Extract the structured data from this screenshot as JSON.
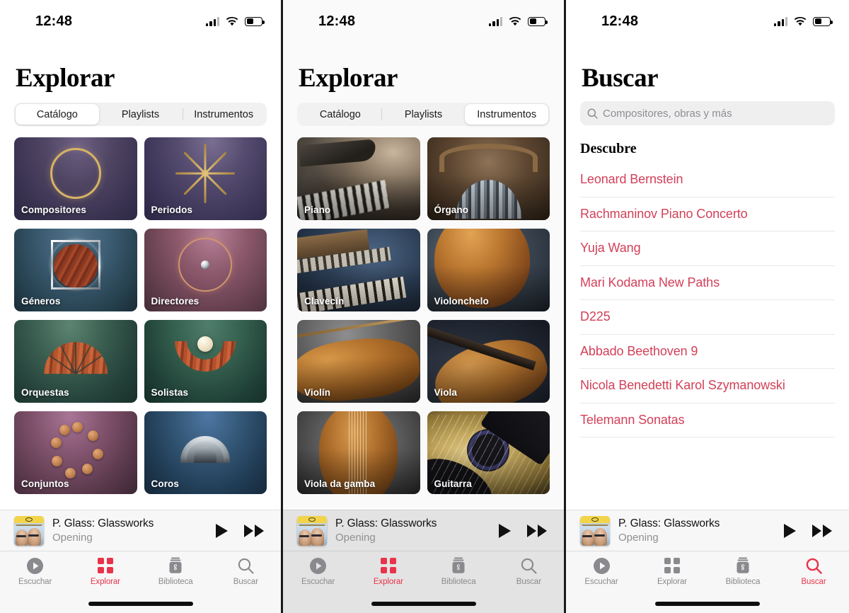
{
  "status": {
    "time": "12:48",
    "cell_icon": "cellular-signal-icon",
    "wifi_icon": "wifi-icon",
    "battery_icon": "battery-low-icon"
  },
  "panels": [
    {
      "id": "explorar-catalogo",
      "title": "Explorar",
      "segmented": {
        "options": [
          "Catálogo",
          "Playlists",
          "Instrumentos"
        ],
        "selected": "Catálogo"
      },
      "tiles": [
        {
          "label": "Compositores",
          "art": "gold-ring-artwork"
        },
        {
          "label": "Periodos",
          "art": "gold-asterisk-artwork"
        },
        {
          "label": "Géneros",
          "art": "wood-disc-artwork"
        },
        {
          "label": "Directores",
          "art": "copper-ring-baton-artwork"
        },
        {
          "label": "Orquestas",
          "art": "terracotta-fan-artwork"
        },
        {
          "label": "Solistas",
          "art": "terracotta-arc-sphere-artwork"
        },
        {
          "label": "Conjuntos",
          "art": "copper-coins-artwork"
        },
        {
          "label": "Coros",
          "art": "chrome-bowl-artwork"
        }
      ]
    },
    {
      "id": "explorar-instrumentos",
      "title": "Explorar",
      "segmented": {
        "options": [
          "Catálogo",
          "Playlists",
          "Instrumentos"
        ],
        "selected": "Instrumentos"
      },
      "tiles": [
        {
          "label": "Piano",
          "art": "piano-photo"
        },
        {
          "label": "Órgano",
          "art": "pipe-organ-photo"
        },
        {
          "label": "Clavecín",
          "art": "harpsichord-photo"
        },
        {
          "label": "Violonchelo",
          "art": "cello-photo"
        },
        {
          "label": "Violín",
          "art": "violin-photo"
        },
        {
          "label": "Viola",
          "art": "viola-photo"
        },
        {
          "label": "Viola da gamba",
          "art": "viola-da-gamba-photo"
        },
        {
          "label": "Guitarra",
          "art": "guitar-photo"
        }
      ]
    },
    {
      "id": "buscar",
      "title": "Buscar",
      "search": {
        "placeholder": "Compositores, obras y más",
        "value": "",
        "icon": "search-icon"
      },
      "discover_heading": "Descubre",
      "suggestions": [
        "Leonard Bernstein",
        "Rachmaninov Piano Concerto",
        "Yuja Wang",
        "Mari Kodama New Paths",
        "D225",
        "Abbado Beethoven 9",
        "Nicola Benedetti Karol Szymanowski",
        "Telemann Sonatas"
      ]
    }
  ],
  "miniplayer": {
    "title": "P. Glass: Glassworks",
    "subtitle": "Opening",
    "artwork": "deutsche-grammophon-album-cover",
    "play_icon": "play-icon",
    "next_icon": "fast-forward-icon"
  },
  "tabbar": {
    "items": [
      {
        "label": "Escuchar",
        "icon": "play-circle-icon",
        "active": false
      },
      {
        "label": "Explorar",
        "icon": "grid-squares-icon",
        "active": true
      },
      {
        "label": "Biblioteca",
        "icon": "library-clef-icon",
        "active": false
      },
      {
        "label": "Buscar",
        "icon": "magnifier-icon",
        "active": false
      }
    ],
    "active_by_panel": [
      "Explorar",
      "Explorar",
      "Buscar"
    ]
  },
  "colors": {
    "accent_red": "#e8334a",
    "suggestion_red": "#d24059",
    "inactive_gray": "#8a8a8e",
    "panel_bg": "#ffffff",
    "dim_panel_bg": "#e3e3e3"
  }
}
